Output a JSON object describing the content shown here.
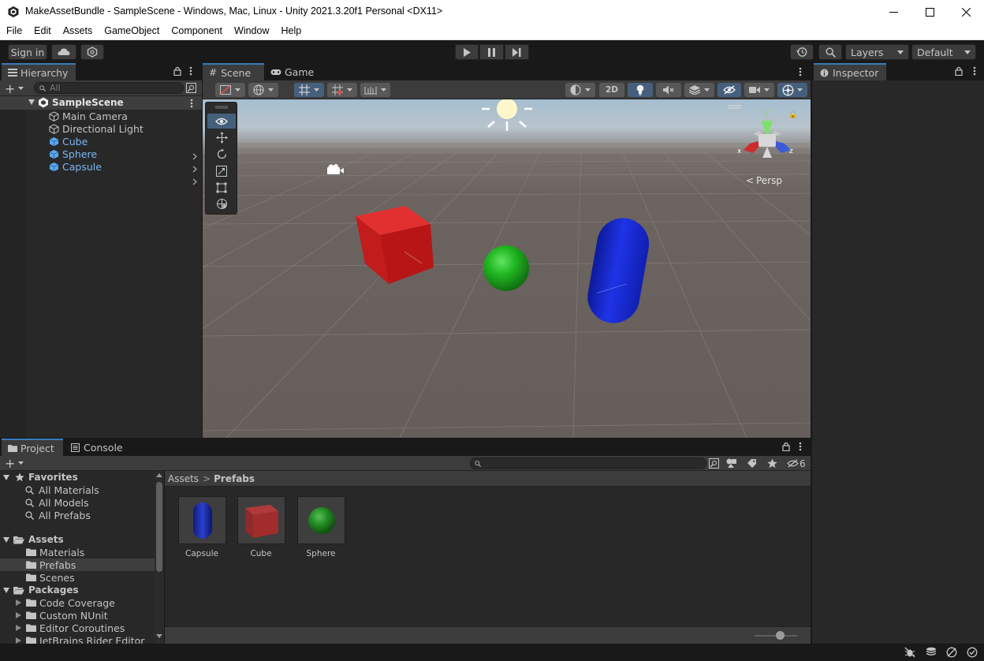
{
  "window": {
    "title": "MakeAssetBundle - SampleScene - Windows, Mac, Linux - Unity 2021.3.20f1 Personal <DX11>",
    "minimize": "—",
    "maximize": "☐",
    "close": "✕"
  },
  "menu": [
    "File",
    "Edit",
    "Assets",
    "GameObject",
    "Component",
    "Window",
    "Help"
  ],
  "toolbar": {
    "sign_in": "Sign in",
    "layers": "Layers",
    "layout": "Default"
  },
  "hierarchy": {
    "tab": "Hierarchy",
    "search_placeholder": "All",
    "scene": "SampleScene",
    "items": [
      {
        "label": "Main Camera"
      },
      {
        "label": "Directional Light"
      },
      {
        "label": "Cube"
      },
      {
        "label": "Sphere"
      },
      {
        "label": "Capsule"
      }
    ]
  },
  "scene_view": {
    "tabs": [
      "Scene",
      "Game"
    ],
    "mode_2d": "2D",
    "persp": "Persp",
    "gizmo_x": "x",
    "gizmo_y": "y",
    "gizmo_z": "z",
    "colors": {
      "sky": "#a9bfcf",
      "ground": "#6b625d",
      "cube": "#d91e1e",
      "sphere": "#23b623",
      "capsule": "#1628d6"
    }
  },
  "inspector": {
    "tab": "Inspector"
  },
  "project": {
    "tabs": [
      "Project",
      "Console"
    ],
    "hidden_count": "6",
    "favorites": {
      "title": "Favorites",
      "items": [
        "All Materials",
        "All Models",
        "All Prefabs"
      ]
    },
    "assets": {
      "title": "Assets",
      "items": [
        "Materials",
        "Prefabs",
        "Scenes"
      ]
    },
    "packages": {
      "title": "Packages",
      "items": [
        "Code Coverage",
        "Custom NUnit",
        "Editor Coroutines",
        "JetBrains Rider Editor"
      ]
    },
    "breadcrumb": {
      "root": "Assets",
      "separator": ">",
      "current": "Prefabs"
    },
    "grid_items": [
      {
        "label": "Capsule"
      },
      {
        "label": "Cube"
      },
      {
        "label": "Sphere"
      }
    ]
  }
}
